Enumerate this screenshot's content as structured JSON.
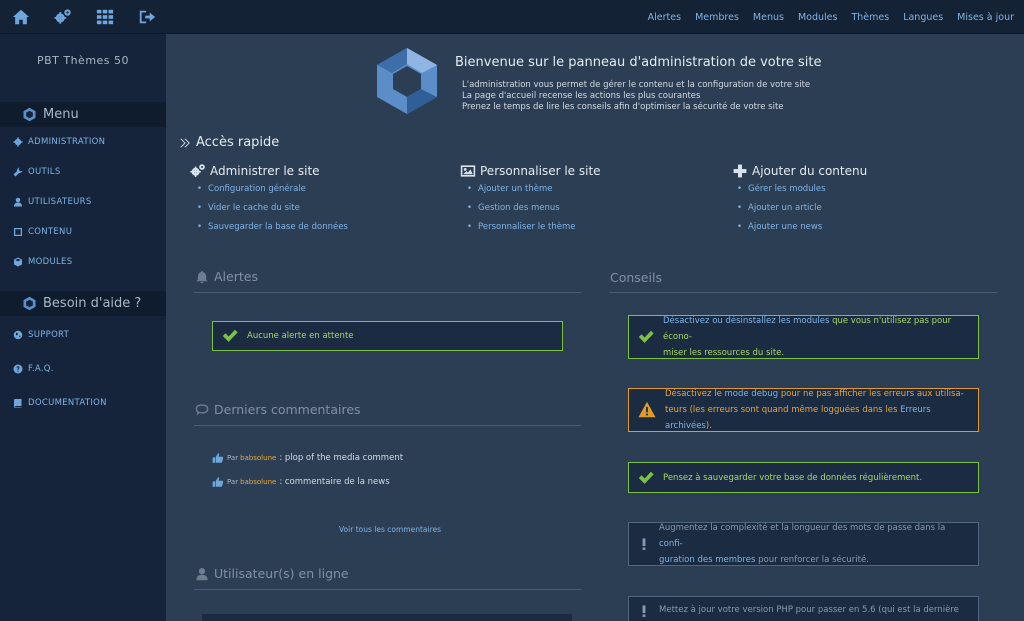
{
  "topbar": {
    "icons": [
      "home-icon",
      "cogs-icon",
      "grid-icon",
      "sign-out-icon"
    ],
    "links": [
      "Alertes",
      "Membres",
      "Menus",
      "Modules",
      "Thèmes",
      "Langues",
      "Mises à jour"
    ]
  },
  "sidebar": {
    "site_title": "PBT Thèmes 50",
    "menu_heading": "Menu",
    "menu_items": [
      "ADMINISTRATION",
      "OUTILS",
      "UTILISATEURS",
      "CONTENU",
      "MODULES"
    ],
    "help_heading": "Besoin d'aide ?",
    "help_items": [
      "SUPPORT",
      "F.A.Q.",
      "DOCUMENTATION"
    ]
  },
  "welcome": {
    "title": "Bienvenue sur le panneau d'administration de votre site",
    "lines": [
      "L'administration vous permet de gérer le contenu et la configuration de votre site",
      "La page d'accueil recense les actions les plus courantes",
      "Prenez le temps de lire les conseils afin d'optimiser la sécurité de votre site"
    ]
  },
  "quick_access": {
    "title": "Accès rapide",
    "columns": [
      {
        "title": "Administrer le site",
        "links": [
          "Configuration générale",
          "Vider le cache du site",
          "Sauvegarder la base de données"
        ]
      },
      {
        "title": "Personnaliser le site",
        "links": [
          "Ajouter un thème",
          "Gestion des menus",
          "Personnaliser le thème"
        ]
      },
      {
        "title": "Ajouter du contenu",
        "links": [
          "Gérer les modules",
          "Ajouter un article",
          "Ajouter une news"
        ]
      }
    ]
  },
  "alerts": {
    "title": "Alertes",
    "message": "Aucune alerte en attente"
  },
  "comments": {
    "title": "Derniers commentaires",
    "by_label": "Par",
    "items": [
      {
        "user": "babsolune",
        "text": ": plop of the media comment"
      },
      {
        "user": "babsolune",
        "text": ": commentaire de la news"
      }
    ],
    "see_all": "Voir tous les commentaires"
  },
  "online": {
    "title": "Utilisateur(s) en ligne"
  },
  "advice": {
    "title": "Conseils",
    "tip1": {
      "a": "Désactivez ou désinstallez les modules",
      "b": " que vous n'utilisez pas pour écono-",
      "c": "miser les ressources du site."
    },
    "tip2": {
      "a": "Désactivez le ",
      "b": "mode debug",
      "c": " pour ne pas afficher les erreurs aux utilisa-",
      "d": "teurs (les erreurs sont quand même logguées dans les ",
      "e": "Erreurs archivées",
      "f": ")."
    },
    "tip3": "Pensez à sauvegarder votre base de données régulièrement.",
    "tip4": {
      "a": "Augmentez la complexité et la longueur des mots de passe dans la ",
      "b": "confi-",
      "c": "guration des membres",
      "d": " pour renforcer la sécurité."
    },
    "tip5": "Mettez à jour votre version PHP pour passer en 5.6 (qui est la dernière"
  },
  "colors": {
    "accent": "#7fb4e6",
    "success": "#7bc142",
    "warning": "#e09a2b",
    "background": "#2c3e54",
    "sidebar": "#15243a"
  }
}
